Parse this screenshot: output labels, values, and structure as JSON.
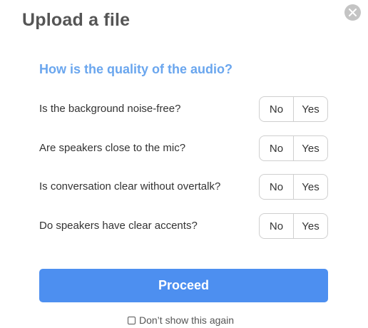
{
  "dialog": {
    "title": "Upload a file",
    "close_icon": "close-icon"
  },
  "audio_quality": {
    "heading": "How is the quality of the audio?",
    "questions": [
      {
        "label": "Is the background noise-free?",
        "no_label": "No",
        "yes_label": "Yes"
      },
      {
        "label": "Are speakers close to the mic?",
        "no_label": "No",
        "yes_label": "Yes"
      },
      {
        "label": "Is conversation clear without overtalk?",
        "no_label": "No",
        "yes_label": "Yes"
      },
      {
        "label": "Do speakers have clear accents?",
        "no_label": "No",
        "yes_label": "Yes"
      }
    ]
  },
  "actions": {
    "proceed_label": "Proceed",
    "dont_show_label": "Don’t show this again",
    "dont_show_checked": false
  },
  "colors": {
    "accent": "#4d8ff0",
    "heading": "#6aa6ee",
    "title": "#555555"
  }
}
